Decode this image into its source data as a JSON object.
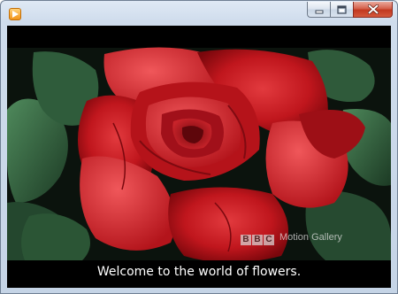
{
  "window": {
    "app_icon": "media-player-icon",
    "controls": {
      "minimize_icon": "minimize-icon",
      "maximize_icon": "maximize-icon",
      "close_icon": "close-icon"
    }
  },
  "video": {
    "subtitle": "Welcome to the world of flowers.",
    "watermark": {
      "brand_letters": [
        "B",
        "B",
        "C"
      ],
      "text": "Motion Gallery"
    }
  },
  "colors": {
    "title_bar": "#d3dfee",
    "close_button": "#c8412a",
    "video_background": "#000000",
    "rose": "#c41a1e",
    "leaves": "#2f5a3a"
  }
}
